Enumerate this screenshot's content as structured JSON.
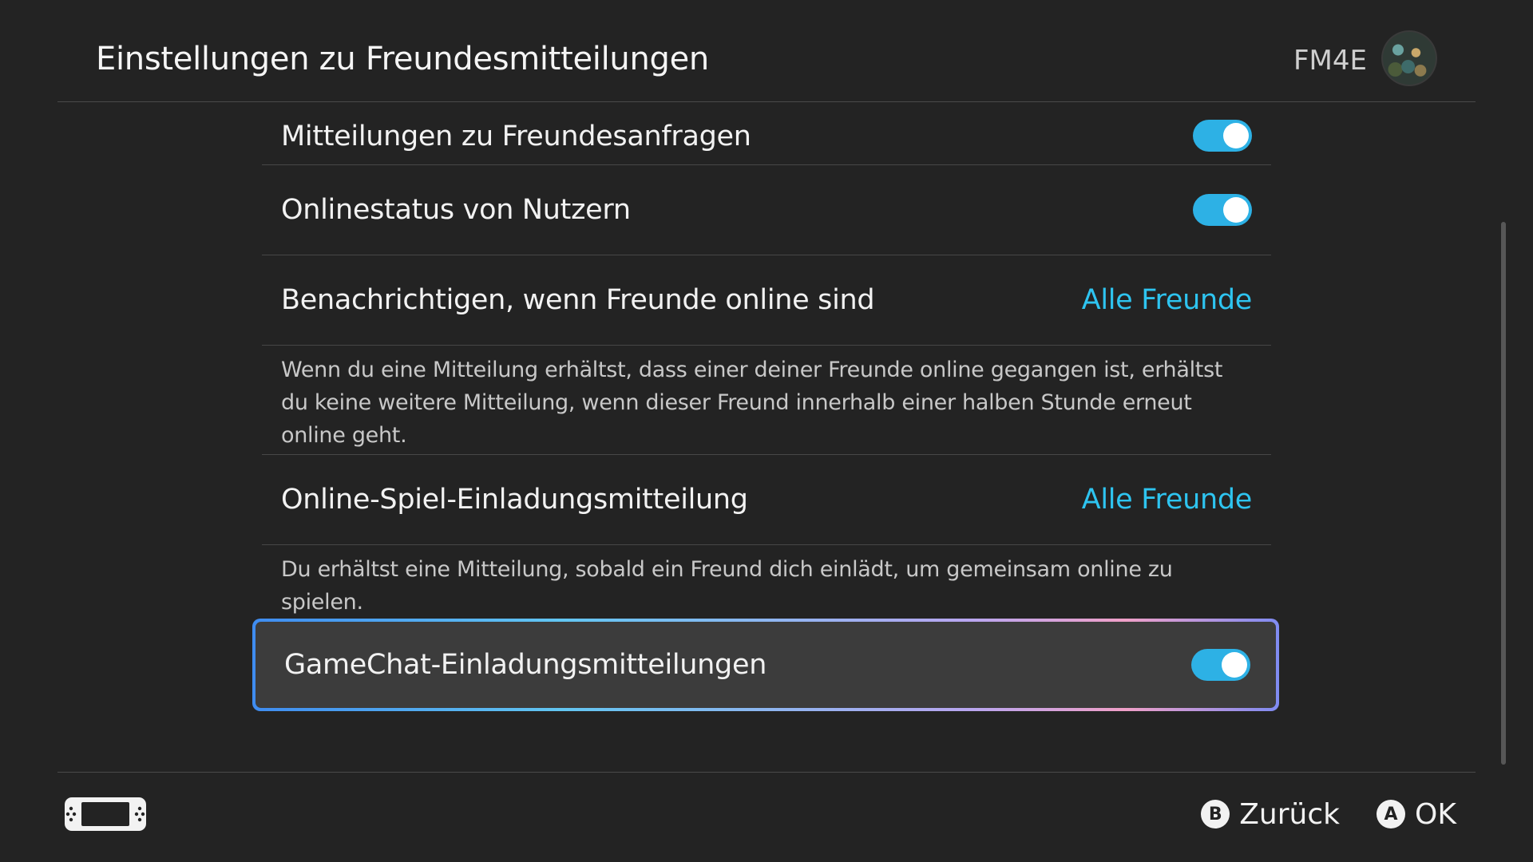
{
  "header": {
    "title": "Einstellungen zu Freundesmitteilungen",
    "user_name": "FM4E"
  },
  "settings": {
    "friend_requests": {
      "label": "Mitteilungen zu Freundesanfragen",
      "enabled": true
    },
    "online_status": {
      "label": "Onlinestatus von Nutzern",
      "enabled": true
    },
    "notify_online": {
      "label": "Benachrichtigen, wenn Freunde online sind",
      "value": "Alle Freunde",
      "description": "Wenn du eine Mitteilung erhältst, dass einer deiner Freunde online gegangen ist, erhältst du keine weitere Mitteilung, wenn dieser Freund innerhalb einer halben Stunde erneut online geht."
    },
    "online_game_invite": {
      "label": "Online-Spiel-Einladungsmitteilung",
      "value": "Alle Freunde",
      "description": "Du erhältst eine Mitteilung, sobald ein Freund dich einlädt, um gemeinsam online zu spielen."
    },
    "gamechat_invite": {
      "label": "GameChat-Einladungsmitteilungen",
      "enabled": true,
      "selected": true
    }
  },
  "footer": {
    "back_button_key": "B",
    "back_label": "Zurück",
    "ok_button_key": "A",
    "ok_label": "OK"
  },
  "colors": {
    "accent": "#2ec4f0",
    "toggle_on": "#2db1e5",
    "background": "#232323"
  },
  "icons": {
    "console": "handheld-console-icon"
  }
}
